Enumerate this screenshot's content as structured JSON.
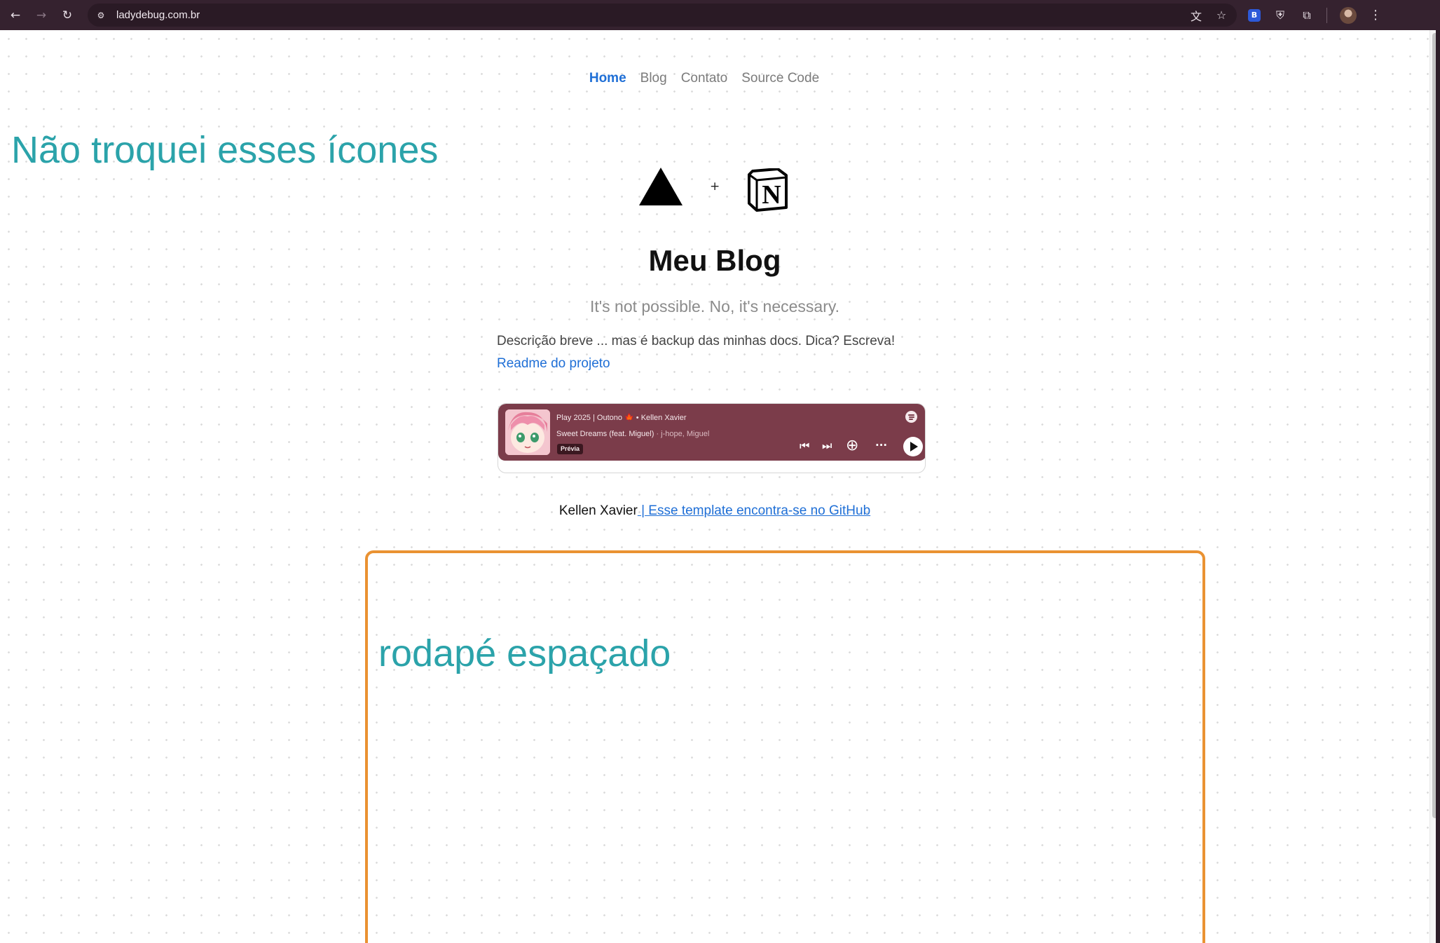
{
  "browser": {
    "url": "ladydebug.com.br",
    "back_glyph": "←",
    "forward_glyph": "→",
    "reload_glyph": "↻",
    "site_info_glyph": "⚙",
    "translate_glyph": "文",
    "bookmark_glyph": "☆",
    "bitwarden_glyph": "B",
    "shield_glyph": "⛨",
    "extensions_glyph": "⧉",
    "menu_glyph": "⋮"
  },
  "nav": {
    "items": [
      {
        "label": "Home",
        "active": true
      },
      {
        "label": "Blog",
        "active": false
      },
      {
        "label": "Contato",
        "active": false
      },
      {
        "label": "Source Code",
        "active": false
      }
    ]
  },
  "annotations": {
    "top_note": "Não troquei esses ícones",
    "bottom_note": "rodapé espaçado",
    "box_color": "#ea9232",
    "text_color": "#2ba3aa"
  },
  "logos": {
    "plus": "+",
    "notion_letter": "N"
  },
  "blog": {
    "title": "Meu Blog",
    "subtitle": "It's not possible. No, it's necessary.",
    "description": "Descrição breve ... mas é backup das minhas docs. Dica? Escreva!",
    "readme_link": "Readme do projeto"
  },
  "spotify": {
    "playlist": "Play 2025 | Outono 🍁 • Kellen Xavier",
    "track": "Sweet Dreams (feat. Miguel)",
    "artists": "· j-hope, Miguel",
    "preview_label": "Prévia",
    "card_color": "#7b3c4a",
    "prev_glyph": "⏮",
    "next_glyph": "⏭",
    "add_glyph": "⊕",
    "more_glyph": "···"
  },
  "footer": {
    "author": "Kellen Xavier",
    "github_text": " | Esse template encontra-se no GitHub"
  },
  "colors": {
    "link": "#1f6fd6",
    "browser_bar": "#35222f"
  }
}
